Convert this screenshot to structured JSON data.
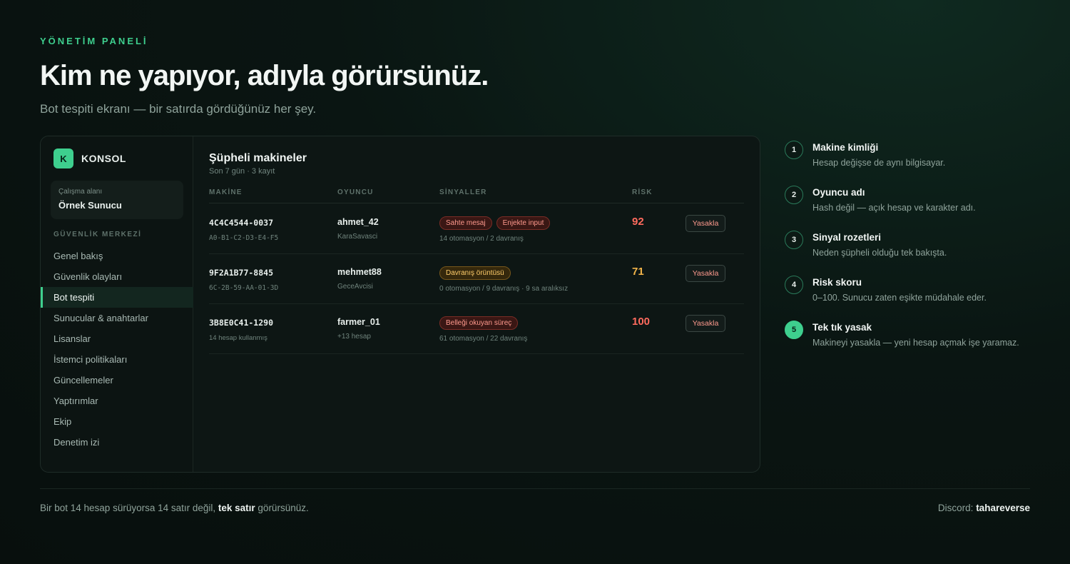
{
  "hero": {
    "eyebrow": "YÖNETİM PANELİ",
    "title": "Kim ne yapıyor, adıyla görürsünüz.",
    "subtitle": "Bot tespiti ekranı — bir satırda gördüğünüz her şey."
  },
  "sidebar": {
    "brand_letter": "K",
    "brand_name": "KONSOL",
    "workspace_label": "Çalışma alanı",
    "workspace_name": "Örnek Sunucu",
    "section_title": "GÜVENLİK MERKEZİ",
    "items": [
      {
        "label": "Genel bakış",
        "active": false
      },
      {
        "label": "Güvenlik olayları",
        "active": false
      },
      {
        "label": "Bot tespiti",
        "active": true
      },
      {
        "label": "Sunucular & anahtarlar",
        "active": false
      },
      {
        "label": "Lisanslar",
        "active": false
      },
      {
        "label": "İstemci politikaları",
        "active": false
      },
      {
        "label": "Güncellemeler",
        "active": false
      },
      {
        "label": "Yaptırımlar",
        "active": false
      },
      {
        "label": "Ekip",
        "active": false
      },
      {
        "label": "Denetim izi",
        "active": false
      }
    ]
  },
  "main": {
    "title": "Şüpheli makineler",
    "subtitle": "Son 7 gün · 3 kayıt",
    "columns": {
      "machine": "MAKİNE",
      "player": "OYUNCU",
      "signals": "SİNYALLER",
      "risk": "RİSK"
    },
    "rows": [
      {
        "machine_id": "4C4C4544-0037",
        "machine_sub": "A0-B1-C2-D3-E4-F5",
        "player": "ahmet_42",
        "player_sub": "KaraSavasci",
        "badges": [
          {
            "text": "Sahte mesaj",
            "tone": "red"
          },
          {
            "text": "Enjekte input",
            "tone": "red"
          }
        ],
        "signals_sub": "14 otomasyon / 2 davranış",
        "risk": "92",
        "risk_color": "#ff6b5e",
        "action": "Yasakla"
      },
      {
        "machine_id": "9F2A1B77-8845",
        "machine_sub": "6C-2B-59-AA-01-3D",
        "player": "mehmet88",
        "player_sub": "GeceAvcisi",
        "badges": [
          {
            "text": "Davranış örüntüsü",
            "tone": "amber"
          }
        ],
        "signals_sub": "0 otomasyon / 9 davranış · 9 sa aralıksız",
        "risk": "71",
        "risk_color": "#f3b54a",
        "action": "Yasakla"
      },
      {
        "machine_id": "3B8E0C41-1290",
        "machine_sub": "14 hesap kullanmış",
        "player": "farmer_01",
        "player_sub": "+13 hesap",
        "badges": [
          {
            "text": "Belleği okuyan süreç",
            "tone": "red"
          }
        ],
        "signals_sub": "61 otomasyon / 22 davranış",
        "risk": "100",
        "risk_color": "#ff6b5e",
        "action": "Yasakla"
      }
    ]
  },
  "steps": [
    {
      "num": "1",
      "title": "Makine kimliği",
      "desc": "Hesap değişse de aynı bilgisayar.",
      "filled": false
    },
    {
      "num": "2",
      "title": "Oyuncu adı",
      "desc": "Hash değil — açık hesap ve karakter adı.",
      "filled": false
    },
    {
      "num": "3",
      "title": "Sinyal rozetleri",
      "desc": "Neden şüpheli olduğu tek bakışta.",
      "filled": false
    },
    {
      "num": "4",
      "title": "Risk skoru",
      "desc": "0–100. Sunucu zaten eşikte müdahale eder.",
      "filled": false
    },
    {
      "num": "5",
      "title": "Tek tık yasak",
      "desc": "Makineyi yasakla — yeni hesap açmak işe yaramaz.",
      "filled": true
    }
  ],
  "footer": {
    "left_prefix": "Bir bot 14 hesap sürüyorsa 14 satır değil, ",
    "left_bold": "tek satır",
    "left_suffix": " görürsünüz.",
    "right_label": "Discord: ",
    "right_bold": "tahareverse"
  },
  "colors": {
    "accent": "#3ecf8e",
    "risk_high": "#ff6b5e",
    "risk_mid": "#f3b54a"
  }
}
